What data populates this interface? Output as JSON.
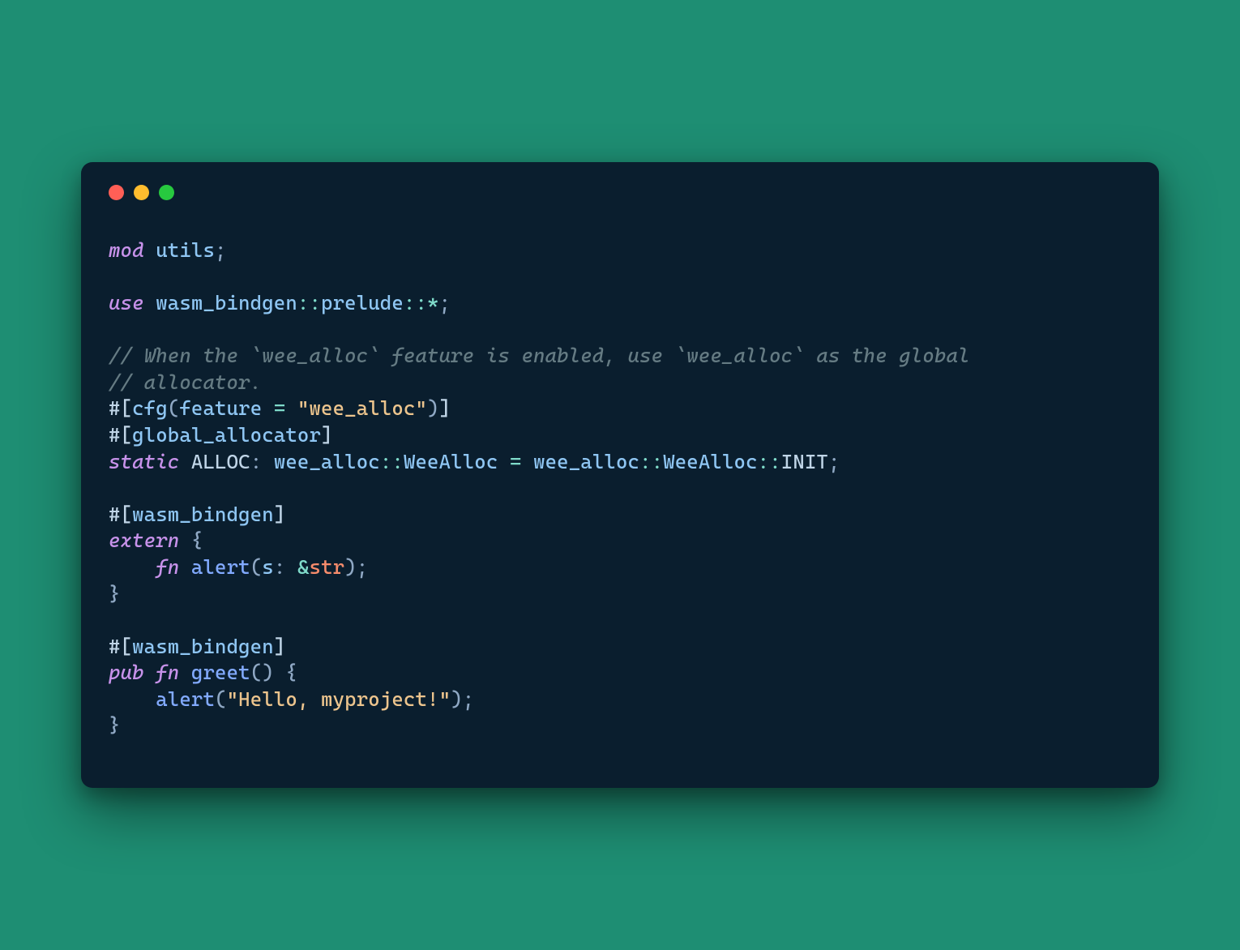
{
  "code": {
    "l1_kw": "mod",
    "l1_ident": " utils",
    "l1_punct": ";",
    "l3_kw": "use",
    "l3_path": " wasm_bindgen",
    "l3_sep1": "::",
    "l3_prelude": "prelude",
    "l3_sep2": "::",
    "l3_star": "*",
    "l3_punct": ";",
    "l5_comment": "// When the `wee_alloc` feature is enabled, use `wee_alloc` as the global",
    "l6_comment": "// allocator.",
    "l7_attr_open": "#[",
    "l7_cfg": "cfg",
    "l7_paren_open": "(",
    "l7_feature": "feature ",
    "l7_eq": "= ",
    "l7_str": "\"wee_alloc\"",
    "l7_paren_close": ")",
    "l7_attr_close": "]",
    "l8_attr_open": "#[",
    "l8_ga": "global_allocator",
    "l8_attr_close": "]",
    "l9_static": "static",
    "l9_alloc": " ALLOC",
    "l9_colon": ": ",
    "l9_path1": "wee_alloc",
    "l9_sep1": "::",
    "l9_weealloc1": "WeeAlloc",
    "l9_eq": " = ",
    "l9_path2": "wee_alloc",
    "l9_sep2": "::",
    "l9_weealloc2": "WeeAlloc",
    "l9_sep3": "::",
    "l9_init": "INIT",
    "l9_semi": ";",
    "l11_attr_open": "#[",
    "l11_wb": "wasm_bindgen",
    "l11_attr_close": "]",
    "l12_extern": "extern",
    "l12_brace": " {",
    "l13_indent": "    ",
    "l13_fn": "fn",
    "l13_alert": " alert",
    "l13_popen": "(",
    "l13_s": "s",
    "l13_colon": ": ",
    "l13_amp": "&",
    "l13_str": "str",
    "l13_pclose": ")",
    "l13_semi": ";",
    "l14_brace": "}",
    "l16_attr_open": "#[",
    "l16_wb": "wasm_bindgen",
    "l16_attr_close": "]",
    "l17_pub": "pub",
    "l17_sp1": " ",
    "l17_fn": "fn",
    "l17_greet": " greet",
    "l17_parens": "()",
    "l17_brace": " {",
    "l18_indent": "    ",
    "l18_alert": "alert",
    "l18_popen": "(",
    "l18_str": "\"Hello, myproject!\"",
    "l18_pclose": ")",
    "l18_semi": ";",
    "l19_brace": "}"
  }
}
